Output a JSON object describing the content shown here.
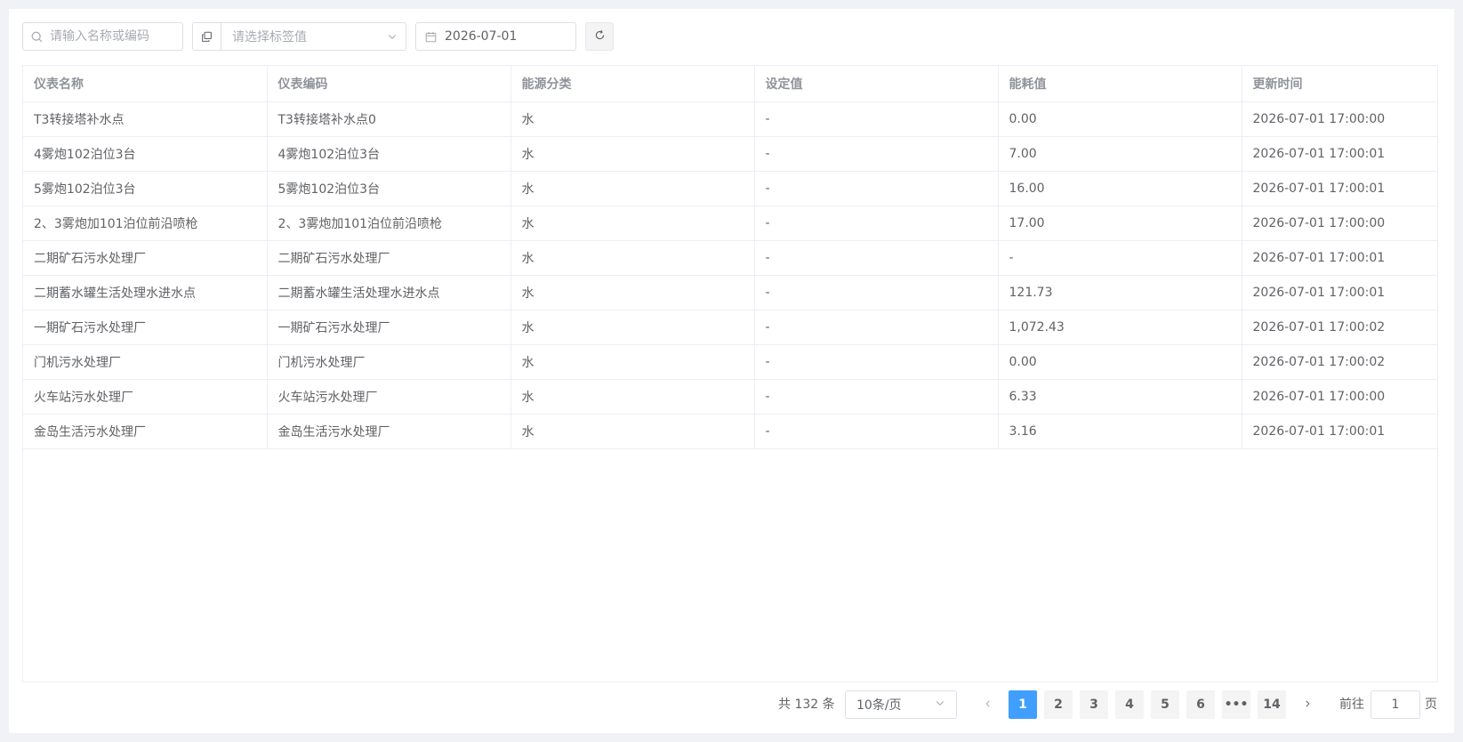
{
  "toolbar": {
    "search_placeholder": "请输入名称或编码",
    "tag_placeholder": "请选择标签值",
    "date_value": "2026-07-01"
  },
  "table": {
    "columns": [
      "仪表名称",
      "仪表编码",
      "能源分类",
      "设定值",
      "能耗值",
      "更新时间"
    ],
    "rows": [
      [
        "T3转接塔补水点",
        "T3转接塔补水点0",
        "水",
        "-",
        "0.00",
        "2026-07-01 17:00:00"
      ],
      [
        "4雾炮102泊位3台",
        "4雾炮102泊位3台",
        "水",
        "-",
        "7.00",
        "2026-07-01 17:00:01"
      ],
      [
        "5雾炮102泊位3台",
        "5雾炮102泊位3台",
        "水",
        "-",
        "16.00",
        "2026-07-01 17:00:01"
      ],
      [
        "2、3雾炮加101泊位前沿喷枪",
        "2、3雾炮加101泊位前沿喷枪",
        "水",
        "-",
        "17.00",
        "2026-07-01 17:00:00"
      ],
      [
        "二期矿石污水处理厂",
        "二期矿石污水处理厂",
        "水",
        "-",
        "-",
        "2026-07-01 17:00:01"
      ],
      [
        "二期蓄水罐生活处理水进水点",
        "二期蓄水罐生活处理水进水点",
        "水",
        "-",
        "121.73",
        "2026-07-01 17:00:01"
      ],
      [
        "一期矿石污水处理厂",
        "一期矿石污水处理厂",
        "水",
        "-",
        "1,072.43",
        "2026-07-01 17:00:02"
      ],
      [
        "门机污水处理厂",
        "门机污水处理厂",
        "水",
        "-",
        "0.00",
        "2026-07-01 17:00:02"
      ],
      [
        "火车站污水处理厂",
        "火车站污水处理厂",
        "水",
        "-",
        "6.33",
        "2026-07-01 17:00:00"
      ],
      [
        "金岛生活污水处理厂",
        "金岛生活污水处理厂",
        "水",
        "-",
        "3.16",
        "2026-07-01 17:00:01"
      ]
    ]
  },
  "pagination": {
    "total_text": "共 132 条",
    "page_size": "10条/页",
    "pages": [
      "1",
      "2",
      "3",
      "4",
      "5",
      "6",
      "•••",
      "14"
    ],
    "current_page": "1",
    "goto_label": "前往",
    "goto_value": "1",
    "page_unit": "页"
  }
}
